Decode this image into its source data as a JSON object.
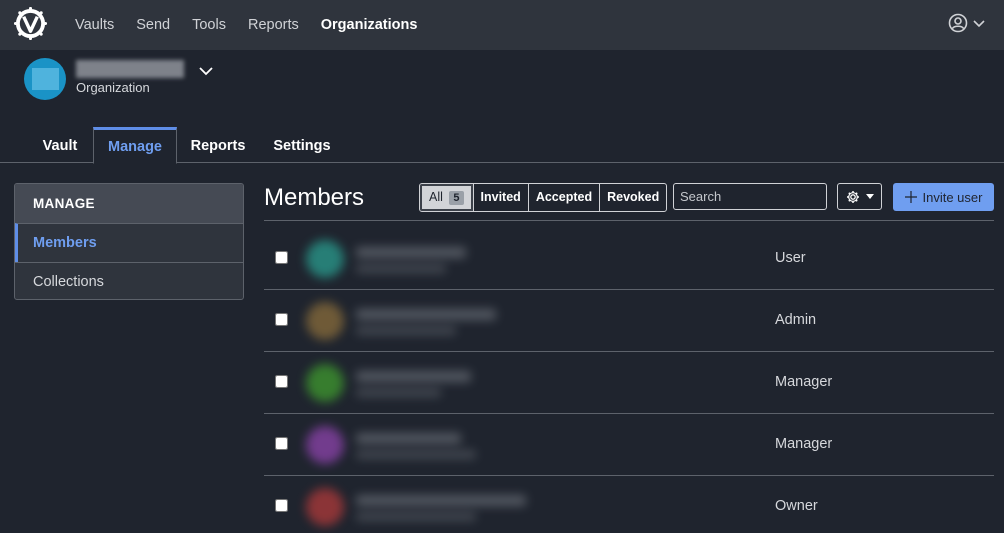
{
  "nav": {
    "items": [
      "Vaults",
      "Send",
      "Tools",
      "Reports",
      "Organizations"
    ],
    "active": "Organizations"
  },
  "org": {
    "subtitle": "Organization"
  },
  "tabs": [
    "Vault",
    "Manage",
    "Reports",
    "Settings"
  ],
  "active_tab": "Manage",
  "side_menu": {
    "heading": "MANAGE",
    "items": [
      "Members",
      "Collections"
    ],
    "active": "Members"
  },
  "main": {
    "title": "Members",
    "filters": [
      {
        "label": "All",
        "count": "5"
      },
      {
        "label": "Invited"
      },
      {
        "label": "Accepted"
      },
      {
        "label": "Revoked"
      }
    ],
    "search_placeholder": "Search",
    "invite_label": "Invite user"
  },
  "members": [
    {
      "role": "User",
      "avatar_color": "#2a9d8f"
    },
    {
      "role": "Admin",
      "avatar_color": "#8a6d3b"
    },
    {
      "role": "Manager",
      "avatar_color": "#3f9b2e"
    },
    {
      "role": "Manager",
      "avatar_color": "#8e44ad"
    },
    {
      "role": "Owner",
      "avatar_color": "#b03a3a"
    }
  ],
  "colors": {
    "accent": "#6f9ef0",
    "topbar": "#2f343d",
    "background": "#1f242e"
  }
}
